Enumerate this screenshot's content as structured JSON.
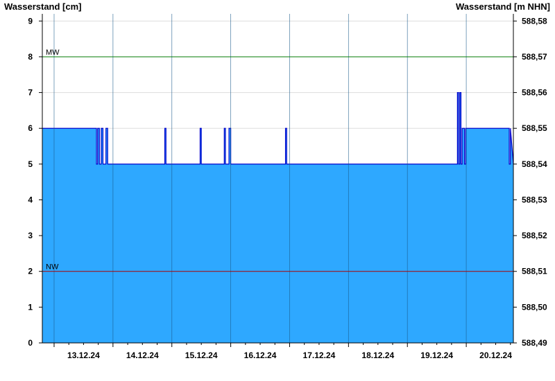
{
  "chart_data": {
    "type": "area",
    "ylabel_left": "Wasserstand [cm]",
    "ylabel_right": "Wasserstand [m NHN]",
    "ylim": [
      0,
      9.2
    ],
    "yticks": [
      0,
      1,
      2,
      3,
      4,
      5,
      6,
      7,
      8,
      9
    ],
    "right_ticks": [
      "588,49",
      "588,50",
      "588,51",
      "588,52",
      "588,53",
      "588,54",
      "588,55",
      "588,56",
      "588,57",
      "588,58"
    ],
    "x_labels": [
      "13.12.24",
      "14.12.24",
      "15.12.24",
      "16.12.24",
      "17.12.24",
      "18.12.24",
      "19.12.24",
      "20.12.24"
    ],
    "x_range_days": [
      12.8,
      20.8
    ],
    "grid": true,
    "fill_color": "#2ea8ff",
    "line_color": "#0000cc",
    "reference_lines": [
      {
        "label": "MW",
        "value": 8,
        "color": "#007a00"
      },
      {
        "label": "NW",
        "value": 2,
        "color": "#aa0000"
      }
    ],
    "series": [
      {
        "x": [
          12.8,
          13.72,
          13.72,
          13.74,
          13.74,
          13.77,
          13.77,
          13.8,
          13.8,
          13.83,
          13.83,
          13.88,
          13.88,
          13.91,
          13.91,
          14.88,
          14.88,
          14.9,
          14.9,
          15.48,
          15.48,
          15.5,
          15.5,
          15.89,
          15.89,
          15.91,
          15.91,
          15.97,
          15.97,
          16.0,
          16.0,
          16.93,
          16.93,
          16.95,
          16.95,
          19.85,
          19.85,
          19.87,
          19.87,
          19.89,
          19.89,
          19.91,
          19.91,
          19.93,
          19.93,
          19.97,
          19.97,
          19.99,
          19.99,
          20.73,
          20.73,
          20.75,
          20.75,
          20.8
        ],
        "y": [
          6,
          6,
          5,
          5,
          6,
          6,
          5,
          5,
          6,
          6,
          5,
          5,
          6,
          6,
          5,
          5,
          6,
          6,
          5,
          5,
          6,
          6,
          5,
          5,
          6,
          6,
          5,
          5,
          6,
          6,
          5,
          5,
          6,
          6,
          5,
          5,
          7,
          7,
          5,
          5,
          7,
          7,
          5,
          5,
          6,
          6,
          5,
          5,
          6,
          6,
          5,
          5,
          6,
          5
        ]
      }
    ]
  }
}
